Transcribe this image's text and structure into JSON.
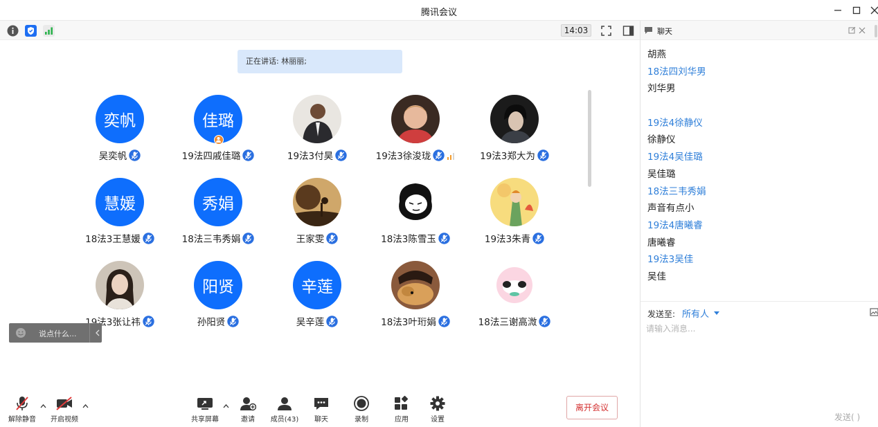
{
  "window": {
    "title": "腾讯会议"
  },
  "toolbar": {
    "time": "14:03"
  },
  "speaker_banner": "正在讲话: 林丽丽;",
  "participants": [
    {
      "name": "吴奕帆",
      "avatar_text": "奕帆"
    },
    {
      "name": "19法四戚佳璐",
      "avatar_text": "佳璐",
      "host": true
    },
    {
      "name": "19法3付昊",
      "avatar_text": ""
    },
    {
      "name": "19法3徐浚珑",
      "avatar_text": ""
    },
    {
      "name": "19法3郑大为",
      "avatar_text": ""
    },
    {
      "name": "18法3王慧媛",
      "avatar_text": "慧媛"
    },
    {
      "name": "18法三韦秀娟",
      "avatar_text": "秀娟"
    },
    {
      "name": "王家雯",
      "avatar_text": ""
    },
    {
      "name": "18法3陈雪玉",
      "avatar_text": ""
    },
    {
      "name": "19法3朱青",
      "avatar_text": ""
    },
    {
      "name": "19法3张让祎",
      "avatar_text": ""
    },
    {
      "name": "孙阳贤",
      "avatar_text": "阳贤"
    },
    {
      "name": "吴辛莲",
      "avatar_text": "辛莲"
    },
    {
      "name": "18法3叶珩娟",
      "avatar_text": ""
    },
    {
      "name": "18法三谢高溦",
      "avatar_text": ""
    }
  ],
  "say_box": {
    "placeholder": "说点什么..."
  },
  "bottom_bar": {
    "unmute": "解除静音",
    "start_video": "开启视频",
    "share_screen": "共享屏幕",
    "invite": "邀请",
    "members": "成员(43)",
    "chat": "聊天",
    "record": "录制",
    "apps": "应用",
    "settings": "设置",
    "leave": "离开会议"
  },
  "chat_panel": {
    "title": "聊天",
    "messages": [
      {
        "kind": "text",
        "text": "胡燕"
      },
      {
        "kind": "name",
        "text": "18法四刘华男"
      },
      {
        "kind": "text",
        "text": "刘华男"
      },
      {
        "kind": "text",
        "text": ""
      },
      {
        "kind": "name",
        "text": "19法4徐静仪"
      },
      {
        "kind": "text",
        "text": "徐静仪"
      },
      {
        "kind": "name",
        "text": "19法4吴佳璐"
      },
      {
        "kind": "text",
        "text": "吴佳璐"
      },
      {
        "kind": "name",
        "text": "18法三韦秀娟"
      },
      {
        "kind": "text",
        "text": "声音有点小"
      },
      {
        "kind": "name",
        "text": "19法4唐曦睿"
      },
      {
        "kind": "text",
        "text": "唐曦睿"
      },
      {
        "kind": "name",
        "text": "19法3吴佳"
      },
      {
        "kind": "text",
        "text": "吴佳"
      }
    ],
    "send_to_label": "发送至:",
    "send_to_value": "所有人",
    "input_placeholder": "请输入消息...",
    "send_button": "发送( )"
  },
  "colors": {
    "brand_blue": "#0e6efd",
    "chat_name": "#2f7fd9",
    "leave_red": "#d43030"
  }
}
